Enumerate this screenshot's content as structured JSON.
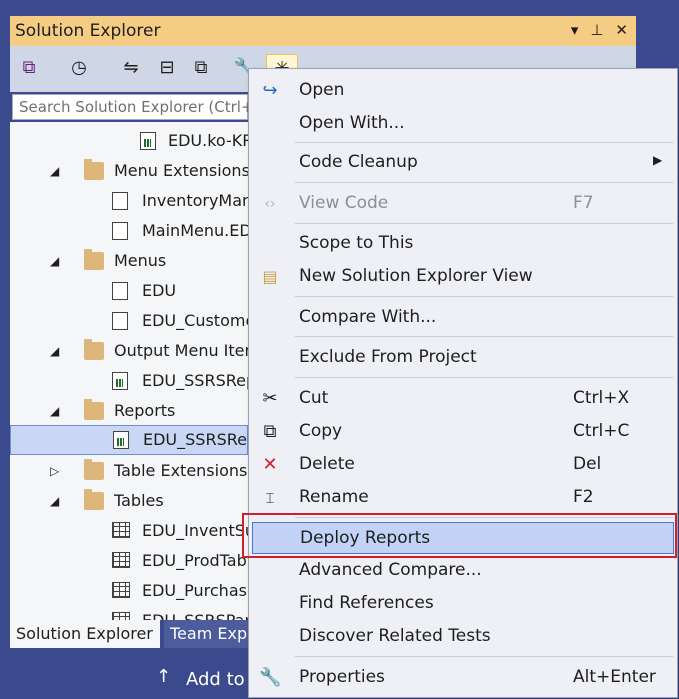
{
  "panel": {
    "title": "Solution Explorer",
    "search_placeholder": "Search Solution Explorer (Ctrl+;)"
  },
  "tree": [
    {
      "label": "EDU.ko-KR"
    },
    {
      "label": "Menu Extensions"
    },
    {
      "label": "InventoryManagement"
    },
    {
      "label": "MainMenu.EDU"
    },
    {
      "label": "Menus"
    },
    {
      "label": "EDU"
    },
    {
      "label": "EDU_Customer"
    },
    {
      "label": "Output Menu Items"
    },
    {
      "label": "EDU_SSRSReport"
    },
    {
      "label": "Reports"
    },
    {
      "label": "EDU_SSRSReport"
    },
    {
      "label": "Table Extensions"
    },
    {
      "label": "Tables"
    },
    {
      "label": "EDU_InventSum"
    },
    {
      "label": "EDU_ProdTable"
    },
    {
      "label": "EDU_PurchaseLine"
    },
    {
      "label": "EDU_SSRSParm"
    }
  ],
  "tabs": [
    {
      "label": "Solution Explorer"
    },
    {
      "label": "Team Explorer"
    }
  ],
  "statusbar": {
    "arrow": "↑",
    "text": "Add to Source Control"
  },
  "menu": {
    "items": [
      {
        "label": "Open",
        "shortcut": ""
      },
      {
        "label": "Open With...",
        "shortcut": ""
      },
      {
        "label": "Code Cleanup",
        "shortcut": ""
      },
      {
        "label": "View Code",
        "shortcut": "F7"
      },
      {
        "label": "Scope to This",
        "shortcut": ""
      },
      {
        "label": "New Solution Explorer View",
        "shortcut": ""
      },
      {
        "label": "Compare With...",
        "shortcut": ""
      },
      {
        "label": "Exclude From Project",
        "shortcut": ""
      },
      {
        "label": "Cut",
        "shortcut": "Ctrl+X"
      },
      {
        "label": "Copy",
        "shortcut": "Ctrl+C"
      },
      {
        "label": "Delete",
        "shortcut": "Del"
      },
      {
        "label": "Rename",
        "shortcut": "F2"
      },
      {
        "label": "Deploy Reports",
        "shortcut": ""
      },
      {
        "label": "Advanced Compare...",
        "shortcut": ""
      },
      {
        "label": "Find References",
        "shortcut": ""
      },
      {
        "label": "Discover Related Tests",
        "shortcut": ""
      },
      {
        "label": "Properties",
        "shortcut": "Alt+Enter"
      }
    ]
  },
  "colors": {
    "accent": "#f5cc84",
    "chrome": "#3a4a8c",
    "highlight": "#c2d3f7",
    "callout": "#d0202e"
  }
}
